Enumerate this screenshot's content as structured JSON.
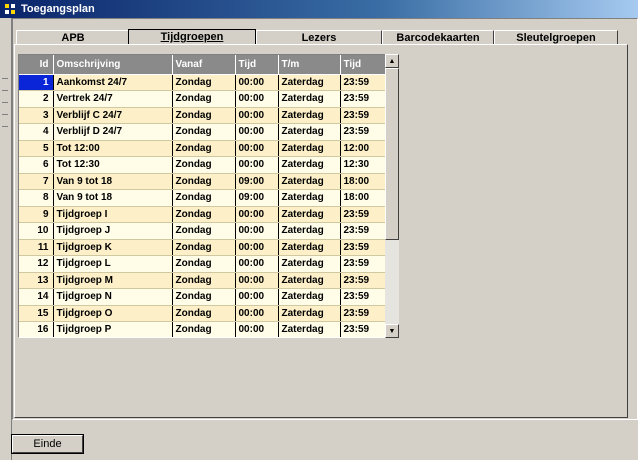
{
  "window": {
    "title": "Toegangsplan"
  },
  "tabs": [
    {
      "label": "APB",
      "active": false
    },
    {
      "label": "Tijdgroepen",
      "active": true
    },
    {
      "label": "Lezers",
      "active": false
    },
    {
      "label": "Barcodekaarten",
      "active": false
    },
    {
      "label": "Sleutelgroepen",
      "active": false
    }
  ],
  "grid": {
    "columns": [
      "Id",
      "Omschrijving",
      "Vanaf",
      "Tijd",
      "T/m",
      "Tijd"
    ],
    "rows": [
      [
        "1",
        "Aankomst 24/7",
        "Zondag",
        "00:00",
        "Zaterdag",
        "23:59"
      ],
      [
        "2",
        "Vertrek 24/7",
        "Zondag",
        "00:00",
        "Zaterdag",
        "23:59"
      ],
      [
        "3",
        "Verblijf C 24/7",
        "Zondag",
        "00:00",
        "Zaterdag",
        "23:59"
      ],
      [
        "4",
        "Verblijf D 24/7",
        "Zondag",
        "00:00",
        "Zaterdag",
        "23:59"
      ],
      [
        "5",
        "Tot 12:00",
        "Zondag",
        "00:00",
        "Zaterdag",
        "12:00"
      ],
      [
        "6",
        "Tot 12:30",
        "Zondag",
        "00:00",
        "Zaterdag",
        "12:30"
      ],
      [
        "7",
        "Van 9 tot 18",
        "Zondag",
        "09:00",
        "Zaterdag",
        "18:00"
      ],
      [
        "8",
        "Van 9 tot 18",
        "Zondag",
        "09:00",
        "Zaterdag",
        "18:00"
      ],
      [
        "9",
        "Tijdgroep I",
        "Zondag",
        "00:00",
        "Zaterdag",
        "23:59"
      ],
      [
        "10",
        "Tijdgroep J",
        "Zondag",
        "00:00",
        "Zaterdag",
        "23:59"
      ],
      [
        "11",
        "Tijdgroep K",
        "Zondag",
        "00:00",
        "Zaterdag",
        "23:59"
      ],
      [
        "12",
        "Tijdgroep L",
        "Zondag",
        "00:00",
        "Zaterdag",
        "23:59"
      ],
      [
        "13",
        "Tijdgroep M",
        "Zondag",
        "00:00",
        "Zaterdag",
        "23:59"
      ],
      [
        "14",
        "Tijdgroep N",
        "Zondag",
        "00:00",
        "Zaterdag",
        "23:59"
      ],
      [
        "15",
        "Tijdgroep O",
        "Zondag",
        "00:00",
        "Zaterdag",
        "23:59"
      ],
      [
        "16",
        "Tijdgroep P",
        "Zondag",
        "00:00",
        "Zaterdag",
        "23:59"
      ]
    ],
    "selected_row": 0
  },
  "buttons": {
    "close_label": "Einde"
  },
  "colors": {
    "row_odd": "#fdf0c8",
    "row_even": "#fffde8",
    "selection": "#0a24d8",
    "header": "#8a8a8a"
  }
}
